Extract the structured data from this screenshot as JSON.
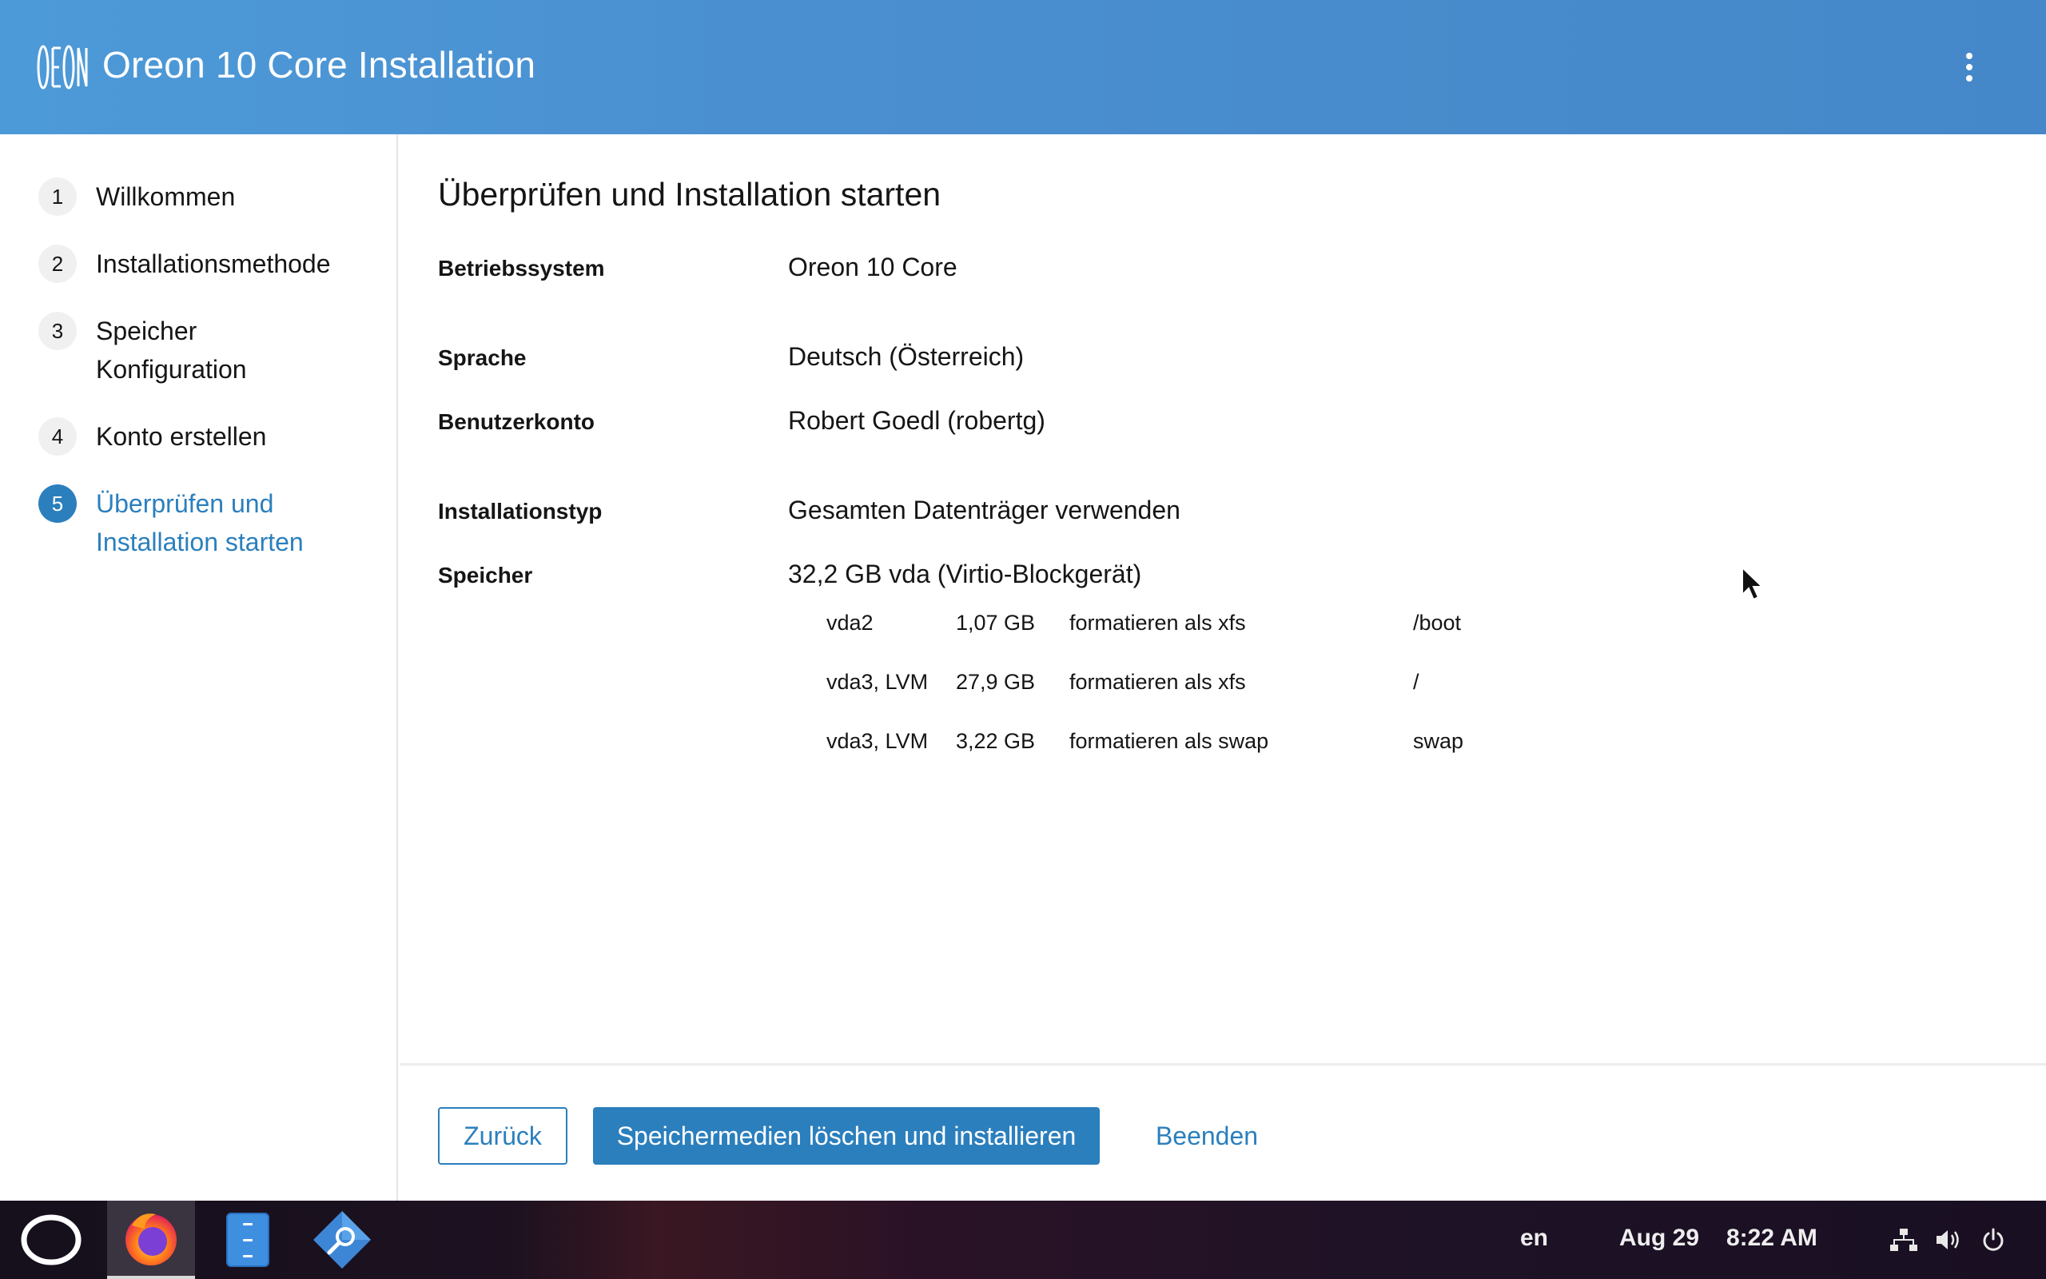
{
  "header": {
    "title": "Oreon 10 Core Installation"
  },
  "sidebar": {
    "steps": [
      {
        "number": "1",
        "label": "Willkommen"
      },
      {
        "number": "2",
        "label": "Installationsmethode"
      },
      {
        "number": "3",
        "label_line1": "Speicher",
        "label_line2": "Konfiguration"
      },
      {
        "number": "4",
        "label": "Konto erstellen"
      },
      {
        "number": "5",
        "label_line1": "Überprüfen und",
        "label_line2": "Installation starten"
      }
    ]
  },
  "review": {
    "title": "Überprüfen und Installation starten",
    "rows": [
      {
        "label": "Betriebssystem",
        "value": "Oreon 10 Core"
      },
      {
        "label": "Sprache",
        "value": "Deutsch (Österreich)"
      },
      {
        "label": "Benutzerkonto",
        "value": "Robert Goedl (robertg)"
      },
      {
        "label": "Installationstyp",
        "value": "Gesamten Datenträger verwenden"
      },
      {
        "label": "Speicher",
        "value": "32,2 GB vda (Virtio-Blockgerät)"
      }
    ],
    "partitions": [
      {
        "device": "vda2",
        "size": "1,07 GB",
        "action": "formatieren als xfs",
        "mount": "/boot"
      },
      {
        "device": "vda3, LVM",
        "size": "27,9 GB",
        "action": "formatieren als xfs",
        "mount": "/"
      },
      {
        "device": "vda3, LVM",
        "size": "3,22 GB",
        "action": "formatieren als swap",
        "mount": "swap"
      }
    ]
  },
  "footer": {
    "back_label": "Zurück",
    "install_label": "Speichermedien löschen und installieren",
    "quit_label": "Beenden"
  },
  "taskbar": {
    "keyboard_layout": "en",
    "date": "Aug 29",
    "time": "8:22 AM"
  },
  "colors": {
    "accent": "#2b7fbd",
    "header": "#4a8fd0"
  }
}
